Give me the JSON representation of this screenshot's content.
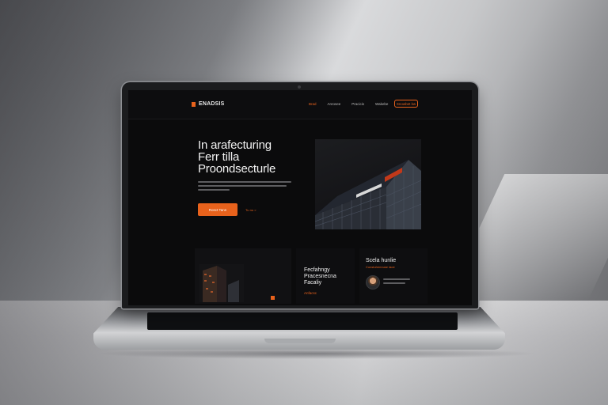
{
  "site": {
    "brand": "ENADSIS",
    "accent_color": "#e8621c",
    "nav": {
      "items": [
        "Brad",
        "Anrosee",
        "Pracicis",
        "Wakebe"
      ],
      "cta": "Snowbet kw"
    },
    "hero": {
      "title_lines": [
        "In arafecturing",
        "Ferr tilla",
        "Proondsecturle"
      ],
      "cta": "Rosct Tann",
      "secondary_link": "Tu nu  >"
    },
    "cards": {
      "middle_title_lines": [
        "Fecfahngy",
        "Pracesnecna",
        "Facaliy"
      ],
      "middle_accent": "Anfacsc",
      "right_title": "Scela hunlie",
      "right_subtitle": "Constuhennuse laoe"
    }
  },
  "icons": {
    "brand": "brand-logo-icon",
    "avatar": "avatar-photo"
  }
}
